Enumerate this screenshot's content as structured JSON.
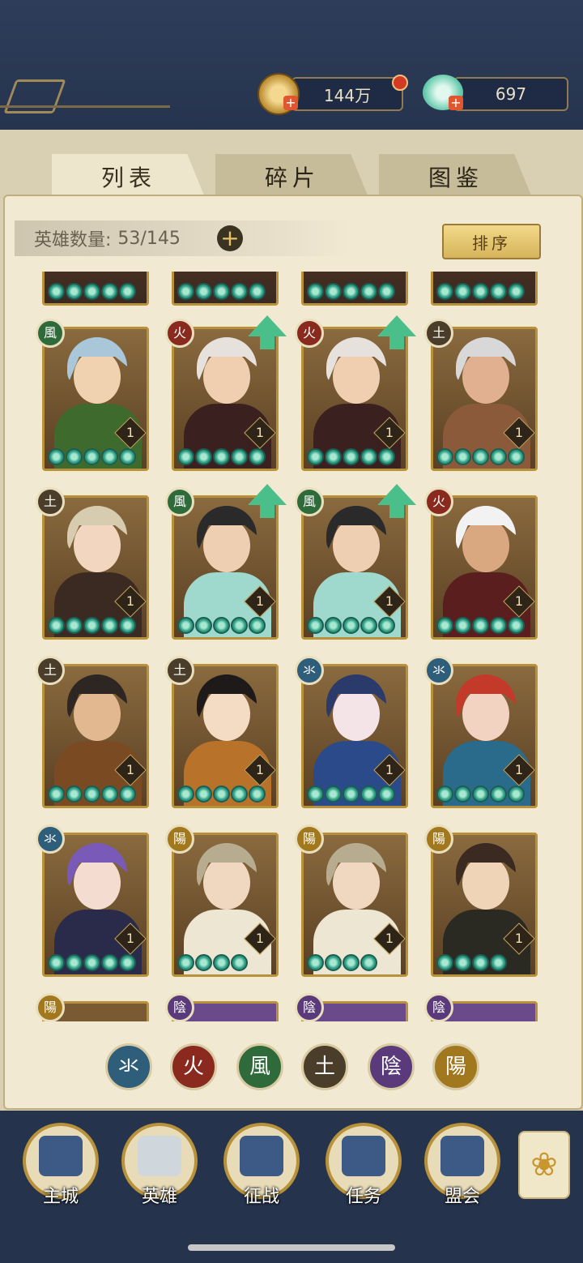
{
  "currency": {
    "coins": "144万",
    "jade": "697"
  },
  "tabs": [
    {
      "label": "列表",
      "active": true
    },
    {
      "label": "碎片",
      "active": false
    },
    {
      "label": "图鉴",
      "active": false
    }
  ],
  "hero_count": {
    "label": "英雄数量:",
    "value": "53/145"
  },
  "sort_label": "排序",
  "element_glyphs": {
    "water": "氺",
    "fire": "火",
    "wind": "風",
    "earth": "土",
    "yin": "陰",
    "yang": "陽"
  },
  "element_colors": {
    "water": "#2f5e7a",
    "fire": "#8a2a1e",
    "wind": "#2f6a3a",
    "earth": "#4a3e2a",
    "yin": "#5a3a7a",
    "yang": "#a2781e"
  },
  "heroes": [
    {
      "element": "wind",
      "level": "1",
      "stars": 5,
      "upgrade": false,
      "hair": "#a9c7d9",
      "skin": "#f0d2b0",
      "outfit": "#3f6a2e"
    },
    {
      "element": "fire",
      "level": "1",
      "stars": 5,
      "upgrade": true,
      "hair": "#e6e1dc",
      "skin": "#efcfb0",
      "outfit": "#3b2020"
    },
    {
      "element": "fire",
      "level": "1",
      "stars": 5,
      "upgrade": true,
      "hair": "#e6e1dc",
      "skin": "#efcfb0",
      "outfit": "#3b2020"
    },
    {
      "element": "earth",
      "level": "1",
      "stars": 5,
      "upgrade": false,
      "hair": "#d8d8d8",
      "skin": "#e0b090",
      "outfit": "#8a5a3a"
    },
    {
      "element": "earth",
      "level": "1",
      "stars": 5,
      "upgrade": false,
      "hair": "#d8ccb0",
      "skin": "#f2d6c0",
      "outfit": "#3a2a22"
    },
    {
      "element": "wind",
      "level": "1",
      "stars": 5,
      "upgrade": true,
      "hair": "#2a2a2a",
      "skin": "#eecfb2",
      "outfit": "#9fd8cc"
    },
    {
      "element": "wind",
      "level": "1",
      "stars": 5,
      "upgrade": true,
      "hair": "#2a2a2a",
      "skin": "#eecfb2",
      "outfit": "#9fd8cc"
    },
    {
      "element": "fire",
      "level": "1",
      "stars": 5,
      "upgrade": false,
      "hair": "#f2f2f2",
      "skin": "#d9a880",
      "outfit": "#5a1e1e"
    },
    {
      "element": "earth",
      "level": "1",
      "stars": 5,
      "upgrade": false,
      "hair": "#2e2622",
      "skin": "#e2b890",
      "outfit": "#7a4a22"
    },
    {
      "element": "earth",
      "level": "1",
      "stars": 5,
      "upgrade": false,
      "hair": "#1e1a1a",
      "skin": "#f4dcc4",
      "outfit": "#b8722a"
    },
    {
      "element": "water",
      "level": "1",
      "stars": 5,
      "upgrade": false,
      "hair": "#2a3a6a",
      "skin": "#f4e4e8",
      "outfit": "#2a4a8a"
    },
    {
      "element": "water",
      "level": "1",
      "stars": 5,
      "upgrade": false,
      "hair": "#c43a2a",
      "skin": "#f2d2c0",
      "outfit": "#2a6a8a"
    },
    {
      "element": "water",
      "level": "1",
      "stars": 5,
      "upgrade": false,
      "hair": "#7a5ab8",
      "skin": "#f4dcd0",
      "outfit": "#2a2a4a"
    },
    {
      "element": "yang",
      "level": "1",
      "stars": 4,
      "upgrade": false,
      "hair": "#b8ac90",
      "skin": "#f0d8c0",
      "outfit": "#ece6d2"
    },
    {
      "element": "yang",
      "level": "1",
      "stars": 4,
      "upgrade": false,
      "hair": "#b8ac90",
      "skin": "#f0d8c0",
      "outfit": "#ece6d2"
    },
    {
      "element": "yang",
      "level": "1",
      "stars": 4,
      "upgrade": false,
      "hair": "#3a2a22",
      "skin": "#f0d4b8",
      "outfit": "#2a2a22"
    }
  ],
  "partial_row_elements": [
    "yang",
    "yin",
    "yin",
    "yin"
  ],
  "filters": [
    "water",
    "fire",
    "wind",
    "earth",
    "yin",
    "yang"
  ],
  "nav": [
    {
      "label": "主城",
      "selected": false
    },
    {
      "label": "英雄",
      "selected": true
    },
    {
      "label": "征战",
      "selected": false
    },
    {
      "label": "任务",
      "selected": false
    },
    {
      "label": "盟会",
      "selected": false
    }
  ],
  "icons": {
    "menu": "flower-menu-icon",
    "coin": "coin-icon",
    "jade": "jade-icon"
  }
}
